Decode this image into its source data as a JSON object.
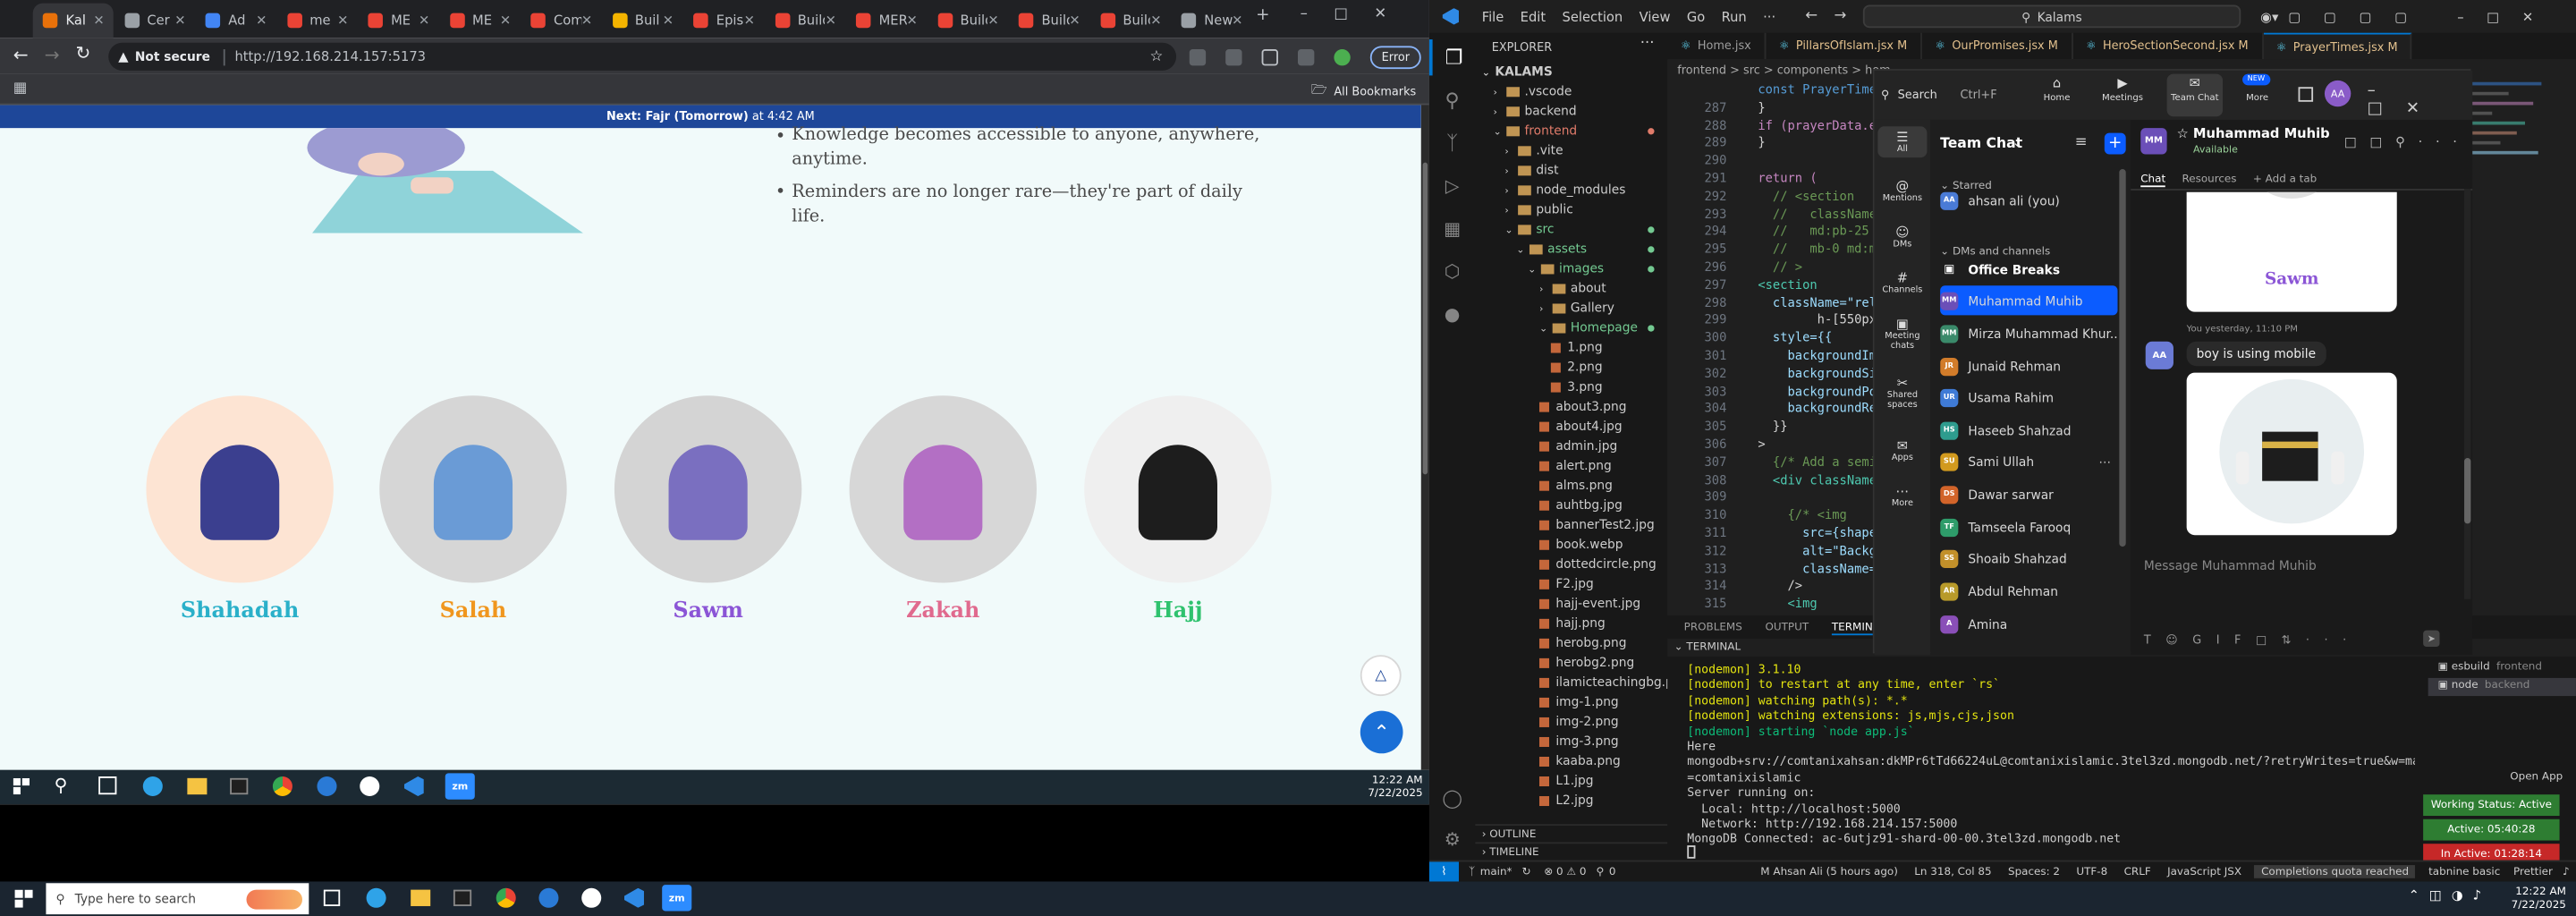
{
  "chrome": {
    "tabs": [
      {
        "label": "Kal",
        "active": true,
        "color": "#e8710a"
      },
      {
        "label": "Cer",
        "color": "#9aa0a6"
      },
      {
        "label": "Ad",
        "color": "#4285f4"
      },
      {
        "label": "me",
        "color": "#ea4335"
      },
      {
        "label": "ME",
        "color": "#ea4335"
      },
      {
        "label": "ME",
        "color": "#ea4335"
      },
      {
        "label": "Comple",
        "color": "#ea4335"
      },
      {
        "label": "Buil",
        "color": "#f4b400"
      },
      {
        "label": "Episod",
        "color": "#ea4335"
      },
      {
        "label": "Build",
        "color": "#ea4335"
      },
      {
        "label": "MERN",
        "color": "#ea4335"
      },
      {
        "label": "Build",
        "color": "#ea4335"
      },
      {
        "label": "Build",
        "color": "#ea4335"
      },
      {
        "label": "Build",
        "color": "#ea4335"
      },
      {
        "label": "New Tab",
        "color": "#9aa0a6"
      }
    ],
    "not_secure": "Not secure",
    "url": "http://192.168.214.157:5173",
    "error_label": "Error",
    "all_bookmarks": "All Bookmarks"
  },
  "page": {
    "banner_prefix": "Next: ",
    "banner_bold": "Fajr (Tomorrow)",
    "banner_suffix": " at 4:42 AM",
    "bullets": [
      "Knowledge becomes accessible to anyone, anywhere,",
      "anytime.",
      "Reminders are no longer rare—they're part of daily",
      "life."
    ],
    "pillars": [
      {
        "name": "Shahadah",
        "color": "#2ab0c9",
        "bg": "#fde4d3"
      },
      {
        "name": "Salah",
        "color": "#f0961e",
        "bg": "#d6d6d6"
      },
      {
        "name": "Sawm",
        "color": "#8b55d6",
        "bg": "#d4d4d4"
      },
      {
        "name": "Zakah",
        "color": "#e06a8e",
        "bg": "#d7d7d7"
      },
      {
        "name": "Hajj",
        "color": "#2fc26e",
        "bg": "#efefef"
      }
    ]
  },
  "taskbar_left": {
    "time": "12:22 AM",
    "date": "7/22/2025"
  },
  "vscode": {
    "menu": [
      "File",
      "Edit",
      "Selection",
      "View",
      "Go",
      "Run",
      "···"
    ],
    "search": "Kalams",
    "explorer_title": "EXPLORER",
    "explorer": [
      {
        "t": "KALAMS",
        "d": 0,
        "bold": true
      },
      {
        "t": ".vscode",
        "d": 1,
        "folder": true
      },
      {
        "t": "backend",
        "d": 1,
        "folder": true
      },
      {
        "t": "frontend",
        "d": 1,
        "folder": true,
        "open": true,
        "color": "#e07b6a"
      },
      {
        "t": ".vite",
        "d": 2,
        "folder": true
      },
      {
        "t": "dist",
        "d": 2,
        "folder": true
      },
      {
        "t": "node_modules",
        "d": 2,
        "folder": true
      },
      {
        "t": "public",
        "d": 2,
        "folder": true
      },
      {
        "t": "src",
        "d": 2,
        "folder": true,
        "open": true,
        "color": "#73c991"
      },
      {
        "t": "assets",
        "d": 3,
        "folder": true,
        "open": true,
        "color": "#73c991"
      },
      {
        "t": "images",
        "d": 4,
        "folder": true,
        "open": true,
        "color": "#73c991"
      },
      {
        "t": "about",
        "d": 5,
        "folder": true
      },
      {
        "t": "Gallery",
        "d": 5,
        "folder": true
      },
      {
        "t": "Homepage",
        "d": 5,
        "folder": true,
        "open": true,
        "color": "#73c991"
      },
      {
        "t": "1.png",
        "d": 6
      },
      {
        "t": "2.png",
        "d": 6
      },
      {
        "t": "3.png",
        "d": 6
      },
      {
        "t": "about3.png",
        "d": 5
      },
      {
        "t": "about4.jpg",
        "d": 5
      },
      {
        "t": "admin.jpg",
        "d": 5
      },
      {
        "t": "alert.png",
        "d": 5
      },
      {
        "t": "alms.png",
        "d": 5
      },
      {
        "t": "auhtbg.jpg",
        "d": 5
      },
      {
        "t": "bannerTest2.jpg",
        "d": 5
      },
      {
        "t": "book.webp",
        "d": 5
      },
      {
        "t": "dottedcircle.png",
        "d": 5
      },
      {
        "t": "F2.jpg",
        "d": 5
      },
      {
        "t": "hajj-event.jpg",
        "d": 5
      },
      {
        "t": "hajj.png",
        "d": 5
      },
      {
        "t": "herobg.png",
        "d": 5
      },
      {
        "t": "herobg2.png",
        "d": 5
      },
      {
        "t": "ilamicteachingbg.p...",
        "d": 5
      },
      {
        "t": "img-1.png",
        "d": 5
      },
      {
        "t": "img-2.png",
        "d": 5
      },
      {
        "t": "img-3.png",
        "d": 5
      },
      {
        "t": "kaaba.png",
        "d": 5
      },
      {
        "t": "L1.jpg",
        "d": 5
      },
      {
        "t": "L2.jpg",
        "d": 5
      }
    ],
    "outline": "OUTLINE",
    "timeline": "TIMELINE",
    "tabs": [
      "Home.jsx",
      "PillarsOfIslam.jsx M",
      "OurPromises.jsx M",
      "HeroSectionSecond.jsx M",
      "PrayerTimes.jsx M"
    ],
    "breadcrumb": "frontend > src > components > hom",
    "code_lines": [
      {
        "n": "",
        "t": "  const PrayerTimes = ("
      },
      {
        "n": "287",
        "t": "  }"
      },
      {
        "n": "288",
        "t": "  if (prayerData.err"
      },
      {
        "n": "289",
        "t": "  }"
      },
      {
        "n": "290",
        "t": ""
      },
      {
        "n": "291",
        "t": "  return ("
      },
      {
        "n": "292",
        "t": "    // <section"
      },
      {
        "n": "293",
        "t": "    //   className=\"r"
      },
      {
        "n": "294",
        "t": "    //   md:pb-25 px-4"
      },
      {
        "n": "295",
        "t": "    //   mb-0 md:mx-0 m"
      },
      {
        "n": "296",
        "t": "    // >"
      },
      {
        "n": "297",
        "t": "  <section"
      },
      {
        "n": "298",
        "t": "    className=\"relativ"
      },
      {
        "n": "299",
        "t": "          h-[550px"
      },
      {
        "n": "300",
        "t": "    style={{"
      },
      {
        "n": "301",
        "t": "      backgroundImage:"
      },
      {
        "n": "302",
        "t": "      backgroundSize:"
      },
      {
        "n": "303",
        "t": "      backgroundPositio"
      },
      {
        "n": "304",
        "t": "      backgroundRepeat:"
      },
      {
        "n": "305",
        "t": "    }}"
      },
      {
        "n": "306",
        "t": "  >"
      },
      {
        "n": "307",
        "t": "    {/* Add a semi-tra"
      },
      {
        "n": "308",
        "t": "    <div className=\"abs"
      },
      {
        "n": "309",
        "t": ""
      },
      {
        "n": "310",
        "t": "      {/* <img"
      },
      {
        "n": "311",
        "t": "        src={shape2}"
      },
      {
        "n": "312",
        "t": "        alt=\"Backgrou"
      },
      {
        "n": "313",
        "t": "        className=\"at"
      },
      {
        "n": "314",
        "t": "      />"
      },
      {
        "n": "315",
        "t": "      <img"
      }
    ],
    "panel_tabs": [
      "PROBLEMS",
      "OUTPUT",
      "TERMINAL"
    ],
    "terminal_title": "TERMINAL",
    "terminal_lines": [
      {
        "t": "[nodemon] 3.1.10",
        "c": "#e5e510"
      },
      {
        "t": "[nodemon] to restart at any time, enter `rs`",
        "c": "#e5e510"
      },
      {
        "t": "[nodemon] watching path(s): *.*",
        "c": "#e5e510"
      },
      {
        "t": "[nodemon] watching extensions: js,mjs,cjs,json",
        "c": "#e5e510"
      },
      {
        "t": "[nodemon] starting `node app.js`",
        "c": "#0dbc79"
      },
      {
        "t": "Here",
        "c": "#cccccc"
      },
      {
        "t": "mongodb+srv://comtanixahsan:dkMPr6tTd66224uL@comtanixislamic.3tel3zd.mongodb.net/?retryWrites=true&w=majority&appName",
        "c": "#cccccc"
      },
      {
        "t": "=comtanixislamic",
        "c": "#cccccc"
      },
      {
        "t": "Server running on:",
        "c": "#cccccc"
      },
      {
        "t": "  Local: http://localhost:5000",
        "c": "#cccccc"
      },
      {
        "t": "  Network: http://192.168.214.157:5000",
        "c": "#cccccc"
      },
      {
        "t": "MongoDB Connected: ac-6utjz91-shard-00-00.3tel3zd.mongodb.net",
        "c": "#cccccc"
      }
    ],
    "term_sessions": [
      {
        "t": "esbuild",
        "s": "frontend"
      },
      {
        "t": "node",
        "s": "backend"
      }
    ],
    "open_app": "Open App",
    "working_status": "Working Status: Active",
    "active_time": "Active: 05:40:28",
    "inactive_time": "In Active: 01:28:14",
    "status": {
      "branch": "main*",
      "errors": "⊗ 0 ⚠ 0",
      "zero": "0",
      "author": "M Ahsan Ali (5 hours ago)",
      "pos": "Ln 318, Col 85",
      "spaces": "Spaces: 2",
      "enc": "UTF-8",
      "eol": "CRLF",
      "lang": "JavaScript JSX",
      "quota": "Completions quota reached",
      "tabnine": "tabnine basic",
      "prettier": "Prettier"
    }
  },
  "zoom": {
    "search": "Search",
    "shortcut": "Ctrl+F",
    "nav": [
      "Home",
      "Meetings",
      "Team Chat",
      "More"
    ],
    "new_badge": "NEW",
    "left_nav": [
      "All",
      "Mentions",
      "DMs",
      "Channels",
      "Meeting chats",
      "Shared spaces",
      "Apps",
      "More"
    ],
    "title": "Team Chat",
    "sections": {
      "starred": "Starred",
      "dms": "DMs and channels"
    },
    "contacts": [
      {
        "name": "ahsan ali (you)",
        "init": "AA",
        "color": "#4a7bd6"
      },
      {
        "name": "Office Breaks",
        "init": "",
        "color": "#555",
        "bold": true,
        "lock": true
      },
      {
        "name": "Muhammad Muhib",
        "init": "MM",
        "color": "#6b4fb8",
        "selected": true
      },
      {
        "name": "Mirza Muhammad Khur...",
        "init": "MM",
        "color": "#3a8a6a"
      },
      {
        "name": "Junaid Rehman",
        "init": "JR",
        "color": "#d27c2a"
      },
      {
        "name": "Usama Rahim",
        "init": "UR",
        "color": "#3f7bd6"
      },
      {
        "name": "Haseeb Shahzad",
        "init": "HS",
        "color": "#2e9c8e"
      },
      {
        "name": "Sami Ullah",
        "init": "SU",
        "color": "#d29a1e"
      },
      {
        "name": "Dawar sarwar",
        "init": "DS",
        "color": "#d2642a"
      },
      {
        "name": "Tamseela Farooq",
        "init": "TF",
        "color": "#2e9c6a"
      },
      {
        "name": "Shoaib Shahzad",
        "init": "SS",
        "color": "#c2902a"
      },
      {
        "name": "Abdul Rehman",
        "init": "AR",
        "color": "#b89a2a"
      },
      {
        "name": "Amina",
        "init": "A",
        "color": "#8a4fb8"
      }
    ],
    "chat_user": "Muhammad Muhib",
    "chat_status": "Available",
    "chat_tabs": [
      "Chat",
      "Resources",
      "+ Add a tab"
    ],
    "img1_caption": "Sawm",
    "msg_meta": "You  yesterday, 11:10 PM",
    "msg_text": "boy is using mobile",
    "composer": "Message Muhammad Muhib"
  },
  "win_taskbar": {
    "search": "Type here to search",
    "time": "12:22 AM",
    "date": "7/22/2025"
  }
}
